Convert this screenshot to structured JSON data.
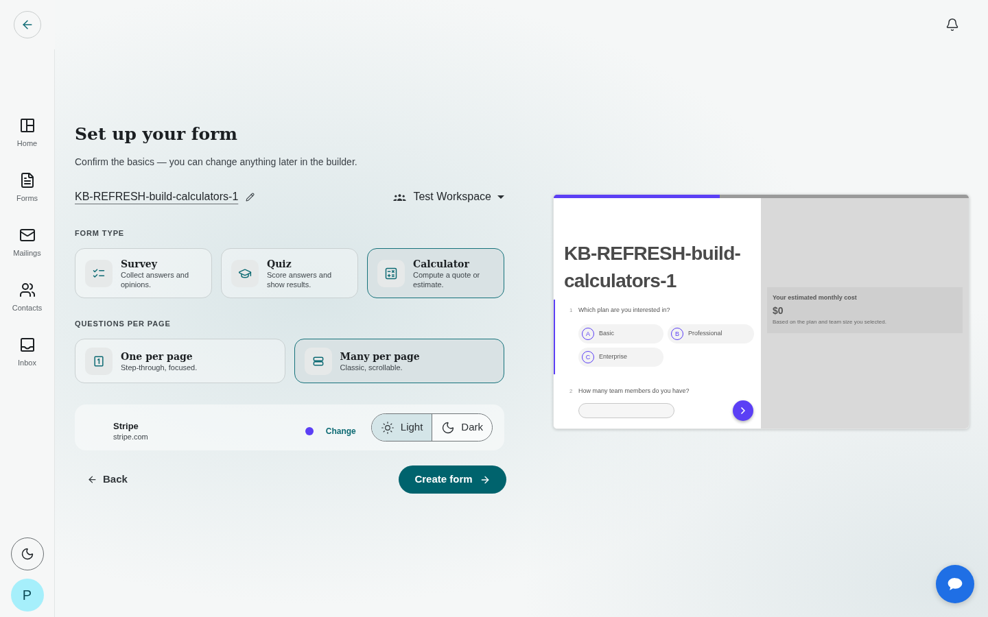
{
  "sidebar": {
    "nav_items": [
      "Home",
      "Forms",
      "Mailings",
      "Contacts",
      "Inbox"
    ],
    "avatar_initial": "P"
  },
  "setup": {
    "title": "Set up your form",
    "subtitle": "Confirm the basics — you can change anything later in the builder.",
    "form_name": "KB-REFRESH-build-calculators-1",
    "workspace": "Test Workspace",
    "form_type": {
      "label": "FORM TYPE",
      "options": [
        {
          "title": "Survey",
          "description": "Collect answers and opinions.",
          "selected": false
        },
        {
          "title": "Quiz",
          "description": "Score answers and show results.",
          "selected": false
        },
        {
          "title": "Calculator",
          "description": "Compute a quote or estimate.",
          "selected": true
        }
      ]
    },
    "questions_per_page": {
      "label": "QUESTIONS PER PAGE",
      "options": [
        {
          "title": "One per page",
          "description": "Step-through, focused.",
          "selected": false
        },
        {
          "title": "Many per page",
          "description": "Classic, scrollable.",
          "selected": true
        }
      ]
    },
    "branding": {
      "name": "Stripe",
      "domain": "stripe.com",
      "color": "#5b3ff5",
      "change_label": "Change",
      "theme_options": [
        {
          "label": "Light",
          "selected": true
        },
        {
          "label": "Dark",
          "selected": false
        }
      ]
    },
    "back_label": "Back",
    "submit_label": "Create form"
  },
  "preview": {
    "progress": {
      "level": 0.4
    },
    "title": "KB-REFRESH-build-calculators-1",
    "questions": [
      {
        "kind": "choice",
        "number": "1",
        "text": "Which plan are you interested in?",
        "active": true,
        "choices": [
          {
            "letter": "A",
            "label": "Basic"
          },
          {
            "letter": "B",
            "label": "Professional"
          },
          {
            "letter": "C",
            "label": "Enterprise"
          }
        ]
      },
      {
        "kind": "number",
        "number": "2",
        "text": "How many team members do you have?",
        "active": false
      }
    ],
    "result": {
      "title": "Your estimated monthly cost",
      "value": "$0",
      "note": "Based on the plan and team size you selected."
    }
  }
}
